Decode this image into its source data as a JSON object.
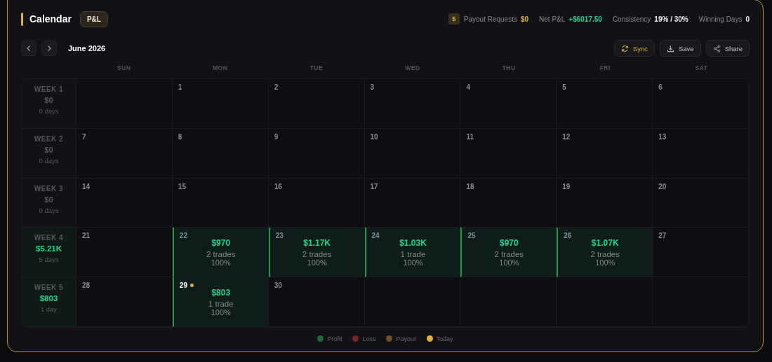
{
  "header": {
    "title": "Calendar",
    "mode_badge": "P&L",
    "stats": [
      {
        "kind": "payout",
        "icon": "$",
        "label": "Payout Requests",
        "value": "$0"
      },
      {
        "kind": "profit",
        "label": "Net P&L",
        "value": "+$6017.50"
      },
      {
        "kind": "plain",
        "label": "Consistency",
        "value": "19% / 30%"
      },
      {
        "kind": "plain",
        "label": "Winning Days",
        "value": "0"
      }
    ]
  },
  "toolbar": {
    "month": "June 2026",
    "buttons": [
      {
        "kind": "sync",
        "label": "Sync"
      },
      {
        "kind": "save",
        "label": "Save"
      },
      {
        "kind": "share",
        "label": "Share"
      }
    ]
  },
  "weekdays": [
    "SUN",
    "MON",
    "TUE",
    "WED",
    "THU",
    "FRI",
    "SAT"
  ],
  "weeks": [
    {
      "label": "WEEK 1",
      "total": "$0",
      "days_count": "0 days",
      "kind": "flat",
      "days": [
        {
          "kind": "blank"
        },
        {
          "kind": "plain",
          "date": "1",
          "today": false
        },
        {
          "kind": "plain",
          "date": "2",
          "today": false
        },
        {
          "kind": "plain",
          "date": "3",
          "today": false
        },
        {
          "kind": "plain",
          "date": "4",
          "today": false
        },
        {
          "kind": "plain",
          "date": "5",
          "today": false
        },
        {
          "kind": "plain",
          "date": "6",
          "today": false
        }
      ]
    },
    {
      "label": "WEEK 2",
      "total": "$0",
      "days_count": "0 days",
      "kind": "flat",
      "days": [
        {
          "kind": "plain",
          "date": "7",
          "today": false
        },
        {
          "kind": "plain",
          "date": "8",
          "today": false
        },
        {
          "kind": "plain",
          "date": "9",
          "today": false
        },
        {
          "kind": "plain",
          "date": "10",
          "today": false
        },
        {
          "kind": "plain",
          "date": "11",
          "today": false
        },
        {
          "kind": "plain",
          "date": "12",
          "today": false
        },
        {
          "kind": "plain",
          "date": "13",
          "today": false
        }
      ]
    },
    {
      "label": "WEEK 3",
      "total": "$0",
      "days_count": "0 days",
      "kind": "flat",
      "days": [
        {
          "kind": "plain",
          "date": "14",
          "today": false
        },
        {
          "kind": "plain",
          "date": "15",
          "today": false
        },
        {
          "kind": "plain",
          "date": "16",
          "today": false
        },
        {
          "kind": "plain",
          "date": "17",
          "today": false
        },
        {
          "kind": "plain",
          "date": "18",
          "today": false
        },
        {
          "kind": "plain",
          "date": "19",
          "today": false
        },
        {
          "kind": "plain",
          "date": "20",
          "today": false
        }
      ]
    },
    {
      "label": "WEEK 4",
      "total": "$5.21K",
      "days_count": "5 days",
      "kind": "profit",
      "days": [
        {
          "kind": "plain",
          "date": "21",
          "today": false
        },
        {
          "kind": "profit",
          "date": "22",
          "today": false,
          "pnl": "$970",
          "trades": "2 trades",
          "win_rate": "100%"
        },
        {
          "kind": "profit",
          "date": "23",
          "today": false,
          "pnl": "$1.17K",
          "trades": "2 trades",
          "win_rate": "100%"
        },
        {
          "kind": "profit",
          "date": "24",
          "today": false,
          "pnl": "$1.03K",
          "trades": "1 trade",
          "win_rate": "100%"
        },
        {
          "kind": "profit",
          "date": "25",
          "today": false,
          "pnl": "$970",
          "trades": "2 trades",
          "win_rate": "100%"
        },
        {
          "kind": "profit",
          "date": "26",
          "today": false,
          "pnl": "$1.07K",
          "trades": "2 trades",
          "win_rate": "100%"
        },
        {
          "kind": "plain",
          "date": "27",
          "today": false
        }
      ]
    },
    {
      "label": "WEEK 5",
      "total": "$803",
      "days_count": "1 day",
      "kind": "profit",
      "days": [
        {
          "kind": "plain",
          "date": "28",
          "today": false
        },
        {
          "kind": "profit",
          "date": "29",
          "today": true,
          "pnl": "$803",
          "trades": "1 trade",
          "win_rate": "100%"
        },
        {
          "kind": "plain",
          "date": "30",
          "today": false
        },
        {
          "kind": "blank"
        },
        {
          "kind": "blank"
        },
        {
          "kind": "blank"
        },
        {
          "kind": "blank"
        }
      ]
    }
  ],
  "legend": [
    {
      "label": "Profit",
      "color": "#1f6b35"
    },
    {
      "label": "Loss",
      "color": "#7a2525"
    },
    {
      "label": "Payout",
      "color": "#6b5526"
    },
    {
      "label": "Today",
      "color": "#e0b040"
    }
  ]
}
